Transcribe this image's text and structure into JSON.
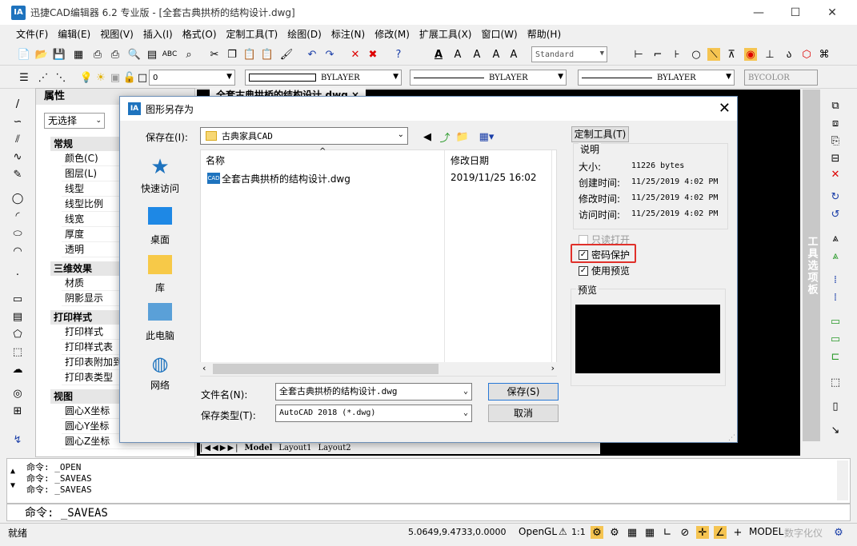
{
  "window": {
    "app_icon": "IA",
    "title": "迅捷CAD编辑器 6.2 专业版 - [全套古典拱桥的结构设计.dwg]",
    "minimize": "—",
    "maximize": "☐",
    "close": "✕"
  },
  "menu": [
    "文件(F)",
    "编辑(E)",
    "视图(V)",
    "插入(I)",
    "格式(O)",
    "定制工具(T)",
    "绘图(D)",
    "标注(N)",
    "修改(M)",
    "扩展工具(X)",
    "窗口(W)",
    "帮助(H)"
  ],
  "toolbar": {
    "text_style": "Standard",
    "layer_value": "0",
    "linetype1": "BYLAYER",
    "linetype2": "BYLAYER",
    "lineweight": "BYLAYER",
    "color": "BYCOLOR"
  },
  "properties": {
    "header": "属性",
    "selection": "无选择",
    "sections": [
      {
        "title": "常规",
        "rows": [
          "颜色(C)",
          "图层(L)",
          "线型",
          "线型比例",
          "线宽",
          "厚度",
          "透明"
        ]
      },
      {
        "title": "三维效果",
        "rows": [
          "材质",
          "阴影显示"
        ]
      },
      {
        "title": "打印样式",
        "rows": [
          "打印样式",
          "打印样式表",
          "打印表附加到",
          "打印表类型"
        ]
      },
      {
        "title": "视图",
        "rows": [
          "圆心X坐标",
          "圆心Y坐标",
          "圆心Z坐标"
        ]
      }
    ]
  },
  "doc_tab": "全套古典拱桥的结构设计.dwg ×",
  "layout_tabs": {
    "model": "Model",
    "layout1": "Layout1",
    "layout2": "Layout2"
  },
  "right_panel_label": "工具选项板",
  "dialog": {
    "icon": "IA",
    "title": "图形另存为",
    "close": "✕",
    "save_in_label": "保存在(I):",
    "save_in_value": "古典家具CAD",
    "places": [
      "快速访问",
      "桌面",
      "库",
      "此电脑",
      "网络"
    ],
    "columns": {
      "name": "名称",
      "date": "修改日期"
    },
    "file": {
      "icon": "CAD",
      "name": "全套古典拱桥的结构设计.dwg",
      "date": "2019/11/25 16:02"
    },
    "filename_label": "文件名(N):",
    "filename_value": "全套古典拱桥的结构设计.dwg",
    "filetype_label": "保存类型(T):",
    "filetype_value": "AutoCAD 2018 (*.dwg)",
    "save_button": "保存(S)",
    "cancel_button": "取消",
    "custom_tools": "定制工具(T)",
    "desc_title": "说明",
    "desc": [
      {
        "label": "大小:",
        "value": "11226 bytes"
      },
      {
        "label": "创建时间:",
        "value": "11/25/2019 4:02 PM"
      },
      {
        "label": "修改时间:",
        "value": "11/25/2019 4:02 PM"
      },
      {
        "label": "访问时间:",
        "value": "11/25/2019 4:02 PM"
      }
    ],
    "readonly": "只读打开",
    "password": "密码保护",
    "use_preview": "使用预览",
    "preview_label": "预览",
    "highlight_color": "#e0302a"
  },
  "command": {
    "lines": [
      "命令:  _OPEN",
      "命令:  _SAVEAS",
      "命令:  _SAVEAS"
    ],
    "prompt": "命令:  _SAVEAS"
  },
  "status": {
    "left": "就绪",
    "coords": "5.0649,9.4733,0.0000",
    "opengl": "OpenGL",
    "scale": "1:1",
    "model": "MODEL",
    "digitizer": "数字化仪"
  }
}
